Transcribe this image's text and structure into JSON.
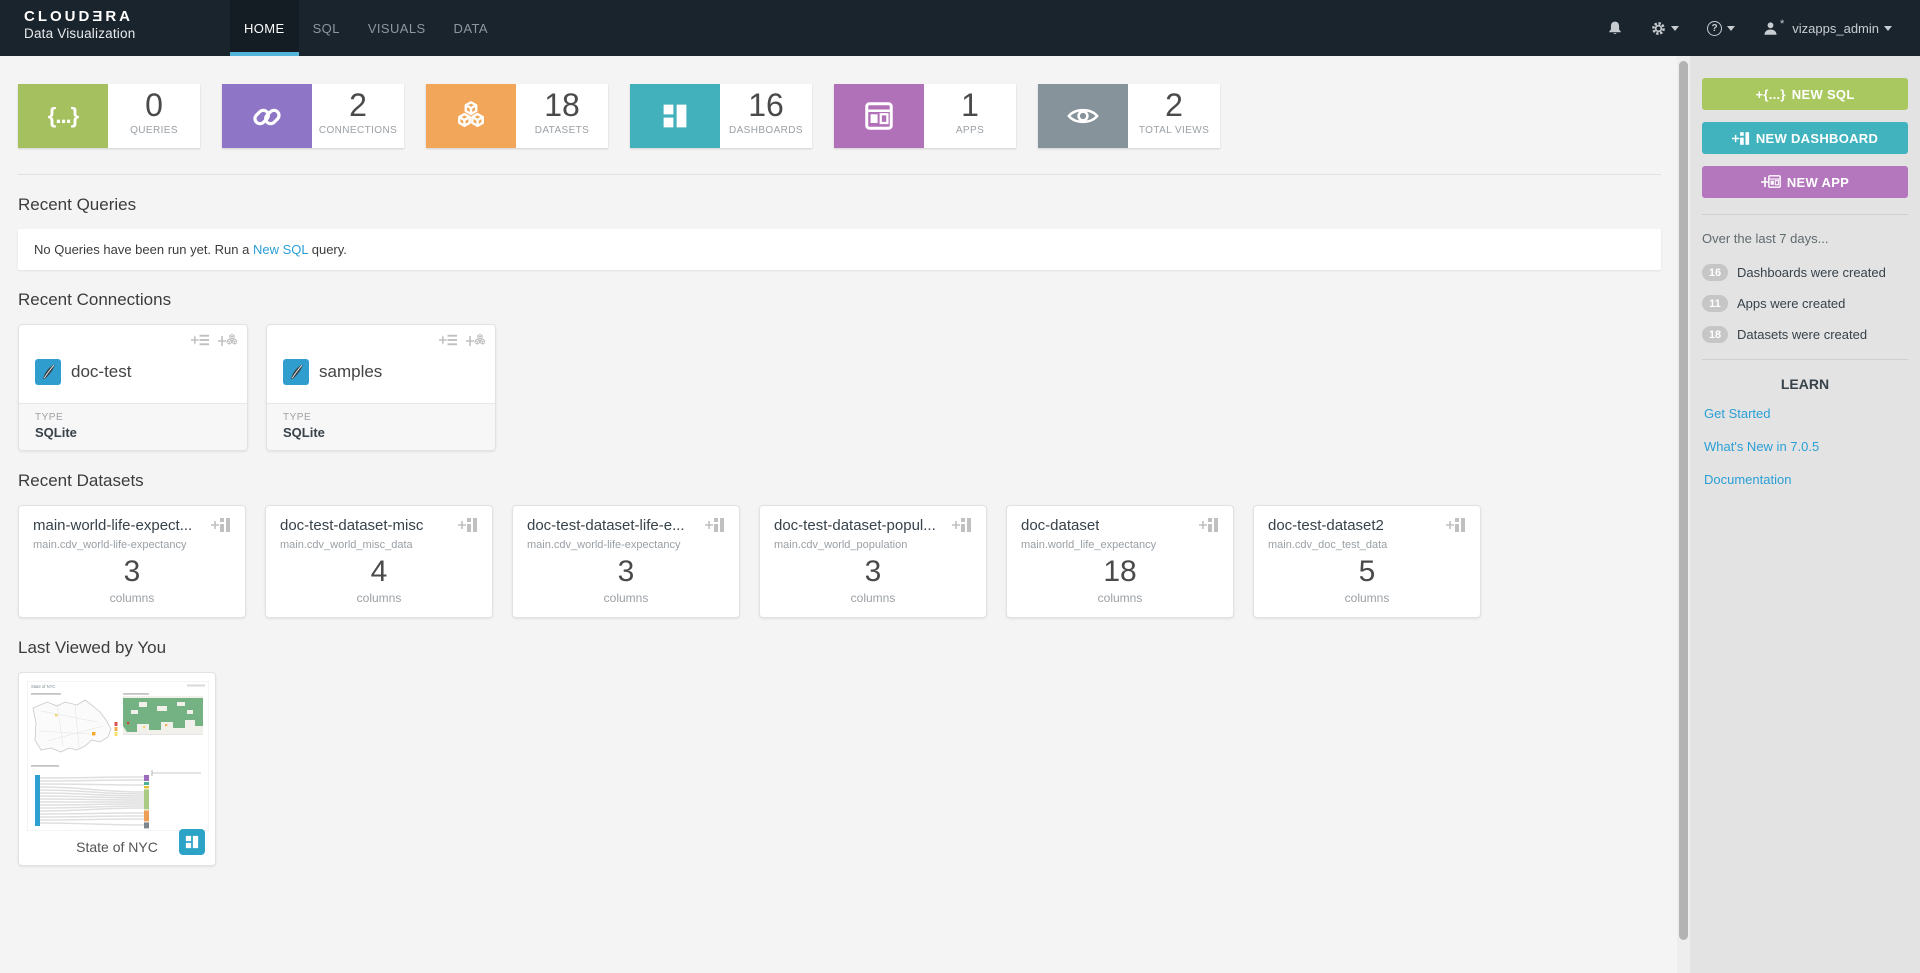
{
  "colors": {
    "navbar_bg": "#1a242c",
    "active_tab_underline": "#54b5d8",
    "queries_green": "#a5c05f",
    "connections_purple": "#8f75c6",
    "datasets_orange": "#f2a65a",
    "dashboards_teal": "#43b1bc",
    "apps_magenta": "#b171b8",
    "views_gray": "#87939b",
    "link_blue": "#2a9fd6",
    "new_sql_btn": "#a9c860",
    "new_dashboard_btn": "#41b3bf",
    "new_app_btn": "#b476bd"
  },
  "navbar": {
    "brand_line1": "CLOUDƎRA",
    "brand_line2": "Data Visualization",
    "tabs": [
      "HOME",
      "SQL",
      "VISUALS",
      "DATA"
    ],
    "username": "vizapps_admin"
  },
  "stats": {
    "items": [
      {
        "value": "0",
        "label": "QUERIES"
      },
      {
        "value": "2",
        "label": "CONNECTIONS"
      },
      {
        "value": "18",
        "label": "DATASETS"
      },
      {
        "value": "16",
        "label": "DASHBOARDS"
      },
      {
        "value": "1",
        "label": "APPS"
      },
      {
        "value": "2",
        "label": "TOTAL VIEWS"
      }
    ]
  },
  "recent_queries": {
    "title": "Recent Queries",
    "empty_prefix": "No Queries have been run yet. Run a ",
    "link_label": "New SQL",
    "empty_suffix": " query."
  },
  "recent_connections": {
    "title": "Recent Connections",
    "cards": [
      {
        "name": "doc-test",
        "type_label": "TYPE",
        "type_value": "SQLite"
      },
      {
        "name": "samples",
        "type_label": "TYPE",
        "type_value": "SQLite"
      }
    ]
  },
  "recent_datasets": {
    "title": "Recent Datasets",
    "cards": [
      {
        "name": "main-world-life-expect...",
        "source": "main.cdv_world-life-expectancy",
        "columns": "3",
        "unit": "columns"
      },
      {
        "name": "doc-test-dataset-misc",
        "source": "main.cdv_world_misc_data",
        "columns": "4",
        "unit": "columns"
      },
      {
        "name": "doc-test-dataset-life-e...",
        "source": "main.cdv_world-life-expectancy",
        "columns": "3",
        "unit": "columns"
      },
      {
        "name": "doc-test-dataset-popul...",
        "source": "main.cdv_world_population",
        "columns": "3",
        "unit": "columns"
      },
      {
        "name": "doc-dataset",
        "source": "main.world_life_expectancy",
        "columns": "18",
        "unit": "columns"
      },
      {
        "name": "doc-test-dataset2",
        "source": "main.cdv_doc_test_data",
        "columns": "5",
        "unit": "columns"
      }
    ]
  },
  "last_viewed": {
    "title": "Last Viewed by You",
    "cards": [
      {
        "name": "State of NYC"
      }
    ]
  },
  "sidebar": {
    "buttons": [
      {
        "label": "NEW SQL"
      },
      {
        "label": "NEW DASHBOARD"
      },
      {
        "label": "NEW APP"
      }
    ],
    "activity": {
      "title": "Over the last 7 days...",
      "items": [
        {
          "count": "16",
          "text": "Dashboards were created"
        },
        {
          "count": "11",
          "text": "Apps were created"
        },
        {
          "count": "18",
          "text": "Datasets were created"
        }
      ]
    },
    "learn": {
      "title": "LEARN",
      "links": [
        "Get Started",
        "What's New in 7.0.5",
        "Documentation"
      ]
    }
  },
  "icons": {
    "queries_glyph": "{...}",
    "new_sql_glyph": "+{...}"
  }
}
